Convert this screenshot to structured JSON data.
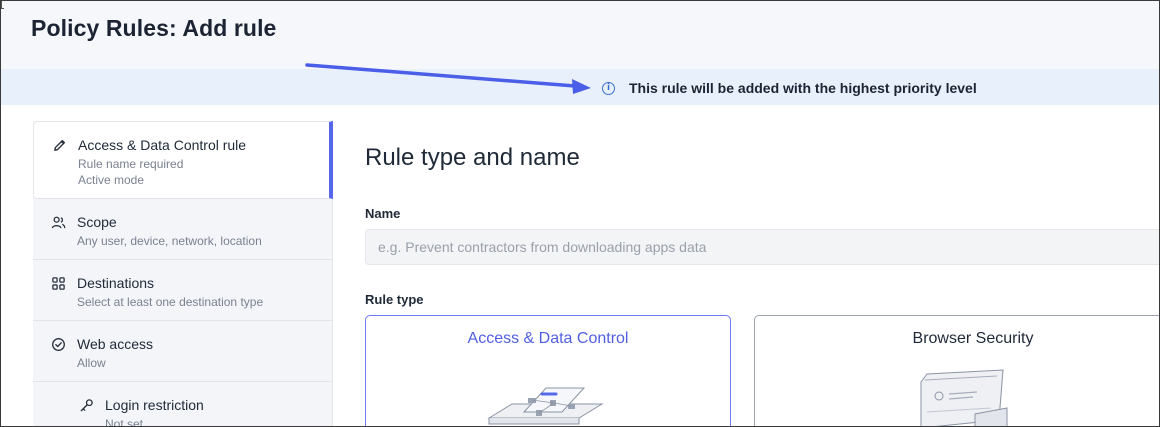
{
  "page": {
    "title": "Policy Rules: Add rule"
  },
  "banner": {
    "icon": "info-icon",
    "text": "This rule will be added with the highest priority level",
    "accent_color": "#3b6fd6",
    "annotation_arrow_color": "#4b5ee8"
  },
  "steps": [
    {
      "icon": "pencil-icon",
      "title": "Access & Data Control rule",
      "sub": "Rule name required",
      "sub2": "Active mode",
      "active": true
    },
    {
      "icon": "users-icon",
      "title": "Scope",
      "sub": "Any user, device, network, location"
    },
    {
      "icon": "grid-icon",
      "title": "Destinations",
      "sub": "Select at least one destination type"
    },
    {
      "icon": "check-circle-icon",
      "title": "Web access",
      "sub": "Allow"
    },
    {
      "icon": "key-icon",
      "title": "Login restriction",
      "sub": "Not set"
    }
  ],
  "form": {
    "section_title": "Rule type and name",
    "name_label": "Name",
    "name_placeholder": "e.g. Prevent contractors from downloading apps data",
    "name_value": "",
    "rule_type_label": "Rule type"
  },
  "rule_types": [
    {
      "label": "Access & Data Control",
      "selected": true
    },
    {
      "label": "Browser Security",
      "selected": false
    }
  ],
  "colors": {
    "accent": "#5468e8",
    "header_bg": "#f5f7fa",
    "banner_bg": "#e8f1fb"
  }
}
